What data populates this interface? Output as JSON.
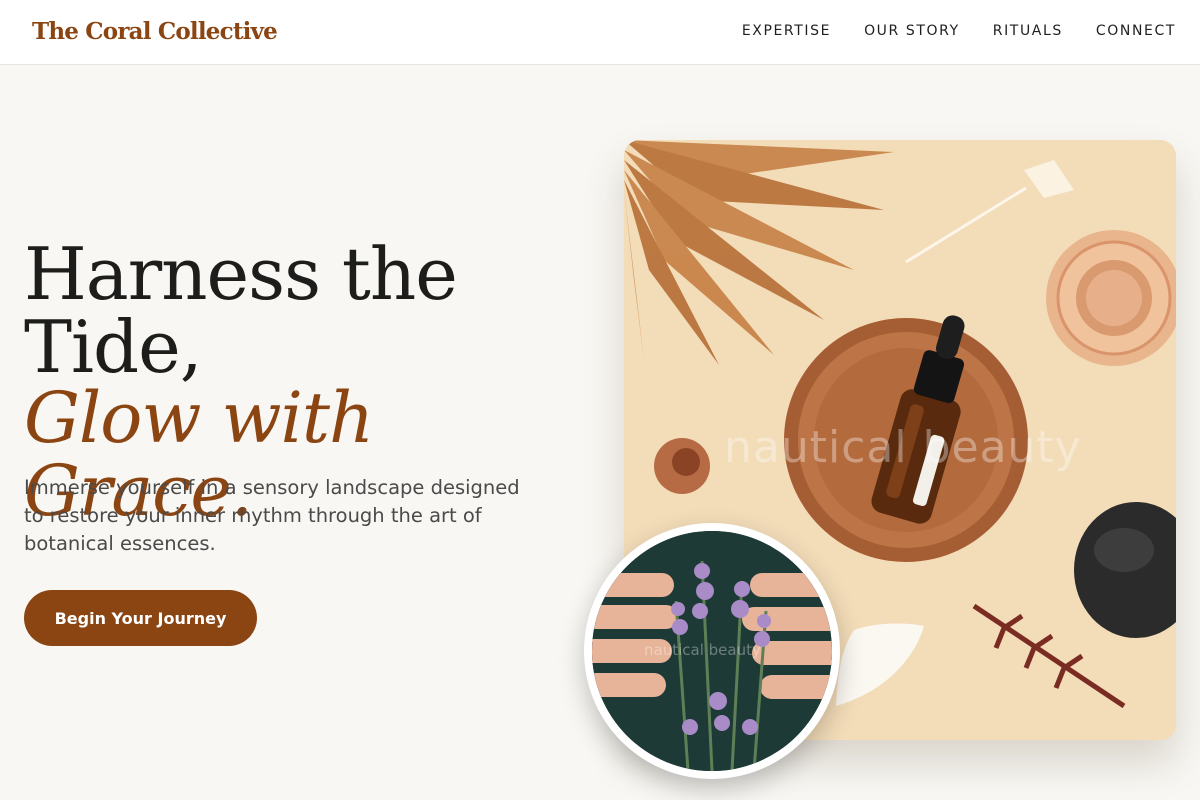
{
  "brand": {
    "name": "The Coral Collective"
  },
  "nav": {
    "items": [
      {
        "label": "EXPERTISE"
      },
      {
        "label": "OUR STORY"
      },
      {
        "label": "RITUALS"
      },
      {
        "label": "CONNECT"
      }
    ]
  },
  "hero": {
    "headline_line1": "Harness the",
    "headline_line2": "Tide,",
    "headline_accent": "Glow with Grace.",
    "description": "Immerse yourself in a sensory landscape designed to restore your inner rhythm through the art of botanical essences.",
    "cta_label": "Begin Your Journey"
  },
  "media": {
    "main_watermark": "nautical beauty",
    "inset_watermark": "nautical beauty"
  },
  "colors": {
    "accent": "#8b4513",
    "background": "#f8f7f3",
    "photo_background": "#f3dcb8"
  }
}
